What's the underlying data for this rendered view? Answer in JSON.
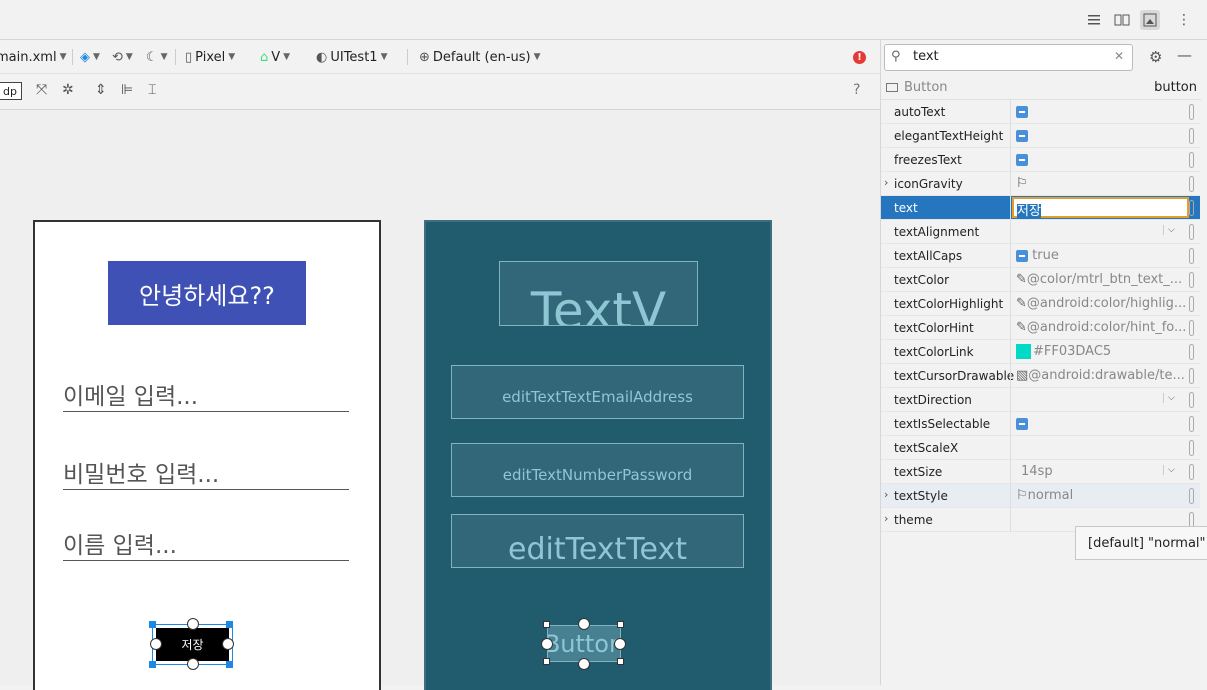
{
  "toolbar": {
    "file_name": "main.xml",
    "device": "Pixel",
    "api": "V",
    "theme": "UITest1",
    "locale": "Default (en-us)",
    "dp_label": "dp",
    "help": "?"
  },
  "design": {
    "greeting": "안녕하세요??",
    "email_hint": "이메일 입력...",
    "password_hint": "비밀번호 입력...",
    "name_hint": "이름 입력...",
    "save_button": "저장"
  },
  "blueprint": {
    "textview": "TextV",
    "email_id": "editTextTextEmailAddress",
    "password_id": "editTextNumberPassword",
    "name_id": "editTextText",
    "button": "Button"
  },
  "attributes": {
    "search_value": "text",
    "header_type": "Button",
    "header_id": "button",
    "rows": [
      {
        "name": "autoText",
        "value": "",
        "kind": "flag"
      },
      {
        "name": "elegantTextHeight",
        "value": "",
        "kind": "flag"
      },
      {
        "name": "freezesText",
        "value": "",
        "kind": "flag"
      },
      {
        "name": "iconGravity",
        "value": "⚐",
        "kind": "text",
        "expandable": true
      },
      {
        "name": "text",
        "value": "저장",
        "kind": "edit"
      },
      {
        "name": "textAlignment",
        "value": "",
        "kind": "dropdown"
      },
      {
        "name": "textAllCaps",
        "value": "true",
        "kind": "flagtext"
      },
      {
        "name": "textColor",
        "value": "@color/mtrl_btn_text_...",
        "kind": "ref"
      },
      {
        "name": "textColorHighlight",
        "value": "@android:color/highlig...",
        "kind": "ref"
      },
      {
        "name": "textColorHint",
        "value": "@android:color/hint_fo...",
        "kind": "ref"
      },
      {
        "name": "textColorLink",
        "value": "#FF03DAC5",
        "kind": "color"
      },
      {
        "name": "textCursorDrawable",
        "value": "@android:drawable/te...",
        "kind": "drawable"
      },
      {
        "name": "textDirection",
        "value": "",
        "kind": "dropdown"
      },
      {
        "name": "textIsSelectable",
        "value": "",
        "kind": "flag"
      },
      {
        "name": "textScaleX",
        "value": "",
        "kind": "text"
      },
      {
        "name": "textSize",
        "value": "14sp",
        "kind": "dropdowntext"
      },
      {
        "name": "textStyle",
        "value": "normal",
        "kind": "flagname",
        "expandable": true
      },
      {
        "name": "theme",
        "value": "",
        "kind": "text",
        "expandable": true
      }
    ],
    "tooltip": "[default] \"normal\""
  },
  "colors": {
    "accent": "#2675bf",
    "link_color_swatch": "#03DAC5",
    "greeting_bg": "#3f51b5",
    "blueprint_bg": "#215b6e",
    "error_dot": "#e53935"
  }
}
